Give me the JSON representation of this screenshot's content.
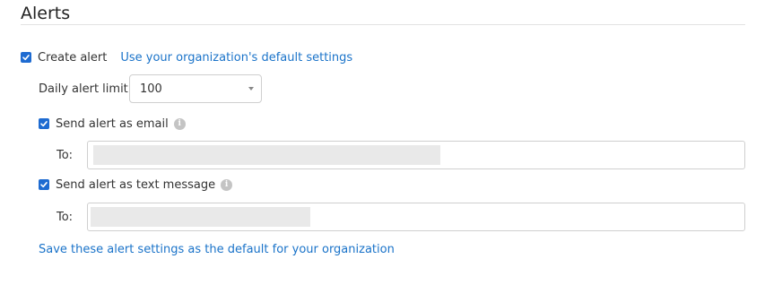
{
  "section": {
    "title": "Alerts"
  },
  "create_alert": {
    "label": "Create alert",
    "checked": true,
    "default_settings_link": "Use your organization's default settings"
  },
  "daily_limit": {
    "label": "Daily alert limit",
    "value": "100"
  },
  "email_alert": {
    "label": "Send alert as email",
    "checked": true,
    "to_label": "To:",
    "value": ""
  },
  "text_alert": {
    "label": "Send alert as text message",
    "checked": true,
    "to_label": "To:",
    "value": ""
  },
  "save_default_link": "Save these alert settings as the default for your organization",
  "colors": {
    "accent": "#1e6bd1",
    "link": "#1a73c9",
    "info_icon": "#c4c4c4"
  },
  "icons": {
    "checkbox": "checkmark-icon",
    "info": "info-icon",
    "dropdown": "chevron-down-icon"
  }
}
